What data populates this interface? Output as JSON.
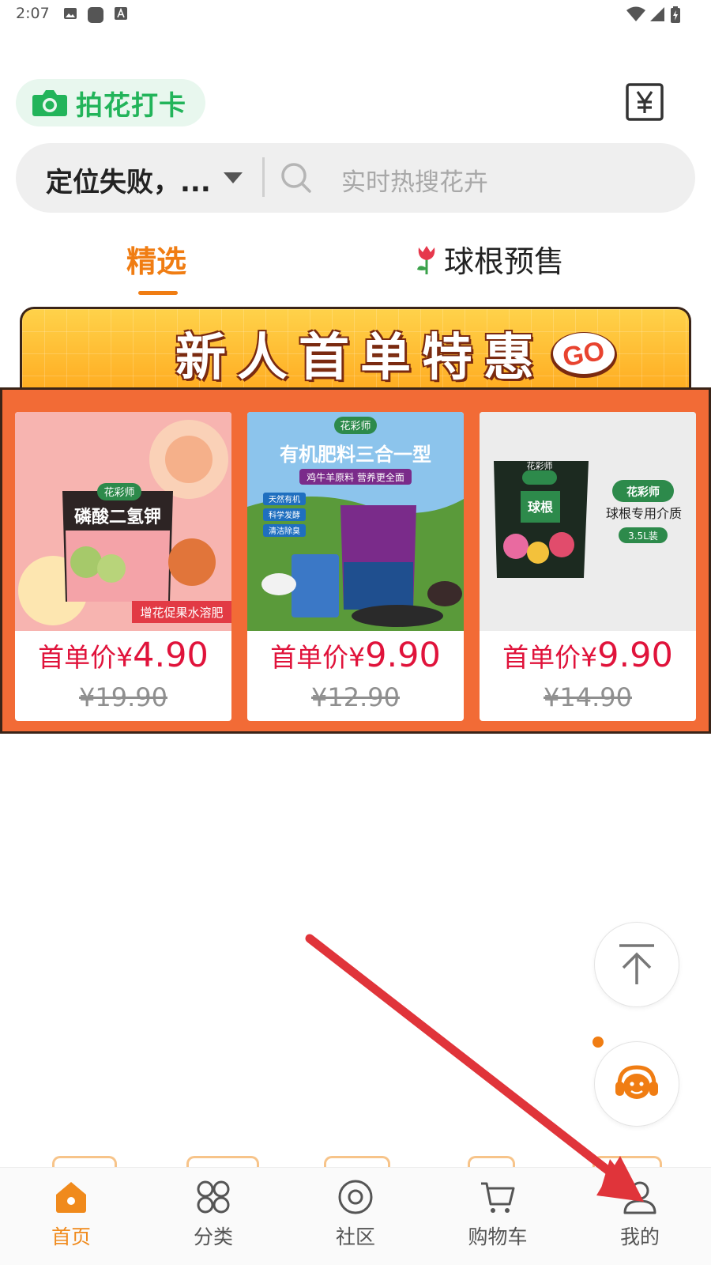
{
  "status_bar": {
    "time": "2:07"
  },
  "header": {
    "checkin_label": "拍花打卡",
    "yen_symbol": "¥"
  },
  "search": {
    "location": "定位失败，...",
    "placeholder": "实时热搜花卉"
  },
  "tabs": [
    {
      "label": "精选",
      "active": true
    },
    {
      "label": "球根预售",
      "active": false
    }
  ],
  "promo": {
    "title": "新人首单特惠",
    "badge": "GO",
    "products": [
      {
        "brand": "花彩师",
        "image_title": "磷酸二氢钾",
        "image_caption": "增花促果水溶肥",
        "price_prefix": "首单价¥",
        "price": "4.90",
        "original_price": "¥19.90"
      },
      {
        "brand": "花彩师",
        "image_title": "有机肥料三合一型",
        "image_subtitle": "鸡牛羊原料 营养更全面",
        "image_tags": [
          "天然有机",
          "科学发酵",
          "清洁除臭"
        ],
        "price_prefix": "首单价¥",
        "price": "9.90",
        "original_price": "¥12.90"
      },
      {
        "brand": "花彩师",
        "image_title": "球根专用介质",
        "image_badge": "3.5L装",
        "bag_label": "球根",
        "price_prefix": "首单价¥",
        "price": "9.90",
        "original_price": "¥14.90"
      }
    ]
  },
  "bottom_nav": [
    {
      "label": "首页",
      "icon": "home-icon",
      "active": true
    },
    {
      "label": "分类",
      "icon": "category-icon",
      "active": false
    },
    {
      "label": "社区",
      "icon": "community-icon",
      "active": false
    },
    {
      "label": "购物车",
      "icon": "cart-icon",
      "active": false
    },
    {
      "label": "我的",
      "icon": "profile-icon",
      "active": false
    }
  ],
  "colors": {
    "accent": "#f07d13",
    "price_red": "#e0133b",
    "promo_orange": "#f26b36",
    "checkin_green": "#22b45a",
    "annotation_arrow": "#e0343a"
  }
}
